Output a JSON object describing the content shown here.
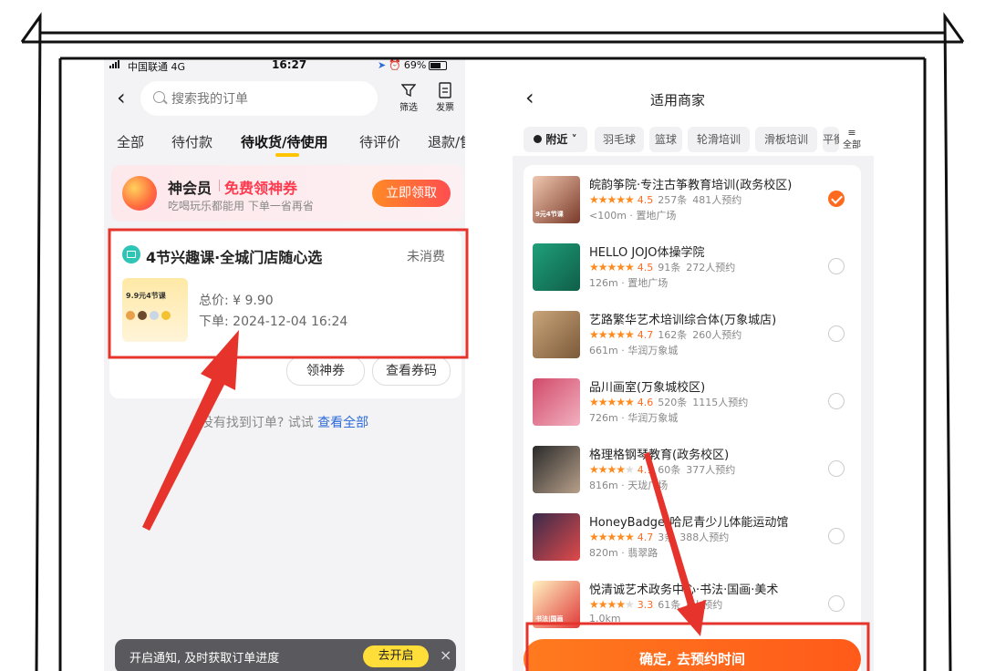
{
  "left": {
    "status": {
      "carrier": "中国联通 4G",
      "time": "16:27",
      "battery": "69%"
    },
    "search_placeholder": "搜索我的订单",
    "filter_label": "筛选",
    "invoice_label": "发票",
    "tabs": [
      "全部",
      "待付款",
      "待收货/待使用",
      "待评价",
      "退款/售"
    ],
    "promo": {
      "brand": "神会员",
      "highlight": "免费领神券",
      "subtitle": "吃喝玩乐都能用 下单一省再省",
      "button": "立即领取"
    },
    "order": {
      "title": "4节兴趣课·全城门店随心选",
      "status": "未消费",
      "thumb_text": "9.9元4节课",
      "price": "总价: ¥ 9.90",
      "time": "下单: 2024-12-04 16:24",
      "btn_coupon": "领神券",
      "btn_view": "查看券码"
    },
    "not_found": "没有找到订单? 试试",
    "view_all": "查看全部",
    "notify": {
      "text": "开启通知, 及时获取订单进度",
      "button": "去开启",
      "close": "×"
    }
  },
  "right": {
    "title": "适用商家",
    "location_chip": "附近",
    "filters": [
      "羽毛球",
      "篮球",
      "轮滑培训",
      "滑板培训",
      "平衡"
    ],
    "all_label": "全部",
    "shops": [
      {
        "name": "皖韵筝院·专注古筝教育培训(政务校区)",
        "score": "4.5",
        "reviews": "257条",
        "bookings": "481人预约",
        "distance": "<100m",
        "area": "置地广场",
        "stars": 4.5,
        "selected": true,
        "img_text": "9元4节课"
      },
      {
        "name": "HELLO JOJO体操学院",
        "score": "4.5",
        "reviews": "91条",
        "bookings": "272人预约",
        "distance": "126m",
        "area": "置地广场",
        "stars": 4.5,
        "selected": false,
        "img_text": ""
      },
      {
        "name": "艺路繁华艺术培训综合体(万象城店)",
        "score": "4.7",
        "reviews": "162条",
        "bookings": "260人预约",
        "distance": "661m",
        "area": "华润万象城",
        "stars": 4.5,
        "selected": false,
        "img_text": ""
      },
      {
        "name": "品川画室(万象城校区)",
        "score": "4.6",
        "reviews": "520条",
        "bookings": "1115人预约",
        "distance": "726m",
        "area": "华润万象城",
        "stars": 4.5,
        "selected": false,
        "img_text": ""
      },
      {
        "name": "格理格钢琴教育(政务校区)",
        "score": "4.1",
        "reviews": "60条",
        "bookings": "377人预约",
        "distance": "816m",
        "area": "天珑广场",
        "stars": 4,
        "selected": false,
        "img_text": ""
      },
      {
        "name": "HoneyBadger哈尼青少儿体能运动馆",
        "score": "4.7",
        "reviews": "3条",
        "bookings": "388人预约",
        "distance": "820m",
        "area": "翡翠路",
        "stars": 4.5,
        "selected": false,
        "img_text": ""
      },
      {
        "name": "悦清诚艺术政务中心·书法·国画·美术",
        "score": "3.3",
        "reviews": "61条",
        "bookings": "4人预约",
        "distance": "1.0km",
        "area": "",
        "stars": 3.5,
        "selected": false,
        "img_text": "书法|国画"
      }
    ],
    "confirm": "确定, 去预约时间"
  },
  "colors": {
    "accent_orange": "#ff6a1e",
    "annotation_red": "#e6342c",
    "promo_red": "#ff3a4e",
    "link_blue": "#2c6bd8",
    "tab_underline": "#ffc400"
  }
}
